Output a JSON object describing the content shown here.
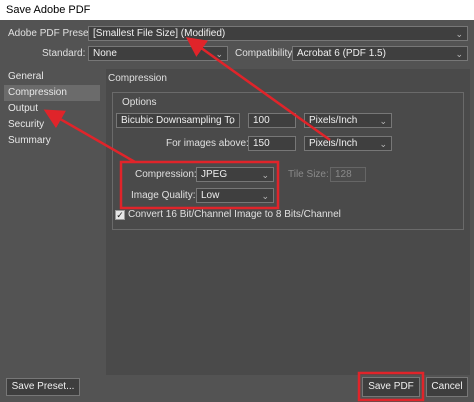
{
  "window": {
    "title": "Save Adobe PDF"
  },
  "preset": {
    "label": "Adobe PDF Preset:",
    "value": "[Smallest File Size] (Modified)"
  },
  "standard": {
    "label": "Standard:",
    "value": "None"
  },
  "compatibility": {
    "label": "Compatibility:",
    "value": "Acrobat 6 (PDF 1.5)"
  },
  "sidebar": {
    "items": [
      {
        "label": "General",
        "active": false
      },
      {
        "label": "Compression",
        "active": true
      },
      {
        "label": "Output",
        "active": false
      },
      {
        "label": "Security",
        "active": false
      },
      {
        "label": "Summary",
        "active": false
      }
    ]
  },
  "section": {
    "title": "Compression"
  },
  "options": {
    "title": "Options",
    "downsampling": {
      "value": "Bicubic Downsampling To",
      "ppi": "100",
      "unit": "Pixels/Inch"
    },
    "above": {
      "label": "For images above:",
      "ppi": "150",
      "unit": "Pixels/Inch"
    },
    "compression": {
      "label": "Compression:",
      "value": "JPEG"
    },
    "quality": {
      "label": "Image Quality:",
      "value": "Low"
    },
    "tile": {
      "label": "Tile Size:",
      "value": "128"
    },
    "convert": {
      "label": "Convert 16 Bit/Channel Image to 8 Bits/Channel",
      "checked": true,
      "mark": "✓"
    }
  },
  "buttons": {
    "save_preset": "Save Preset...",
    "save_pdf": "Save PDF",
    "cancel": "Cancel"
  },
  "chevrons": {
    "down": "⌄"
  },
  "colors": {
    "annotation": "#e0242a",
    "background": "#535353"
  }
}
